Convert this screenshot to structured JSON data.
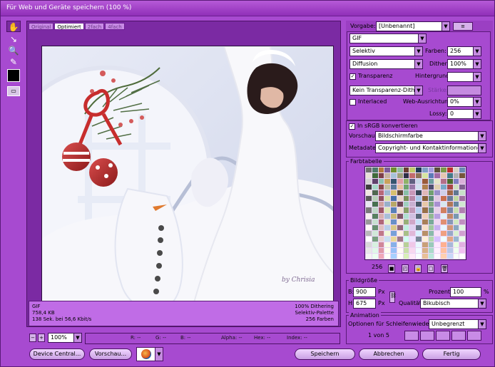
{
  "window": {
    "title": "Für Web und Geräte speichern (100 %)"
  },
  "tabs": [
    "Original",
    "Optimiert",
    "2fach",
    "4fach"
  ],
  "active_tab": 1,
  "preview": {
    "format": "GIF",
    "size": "758,4 KB",
    "time": "138 Sek. bei 56,6 Kbit/s",
    "dithering": "100% Dithering",
    "palette": "Selektiv-Palette",
    "colors": "256 Farben",
    "watermark": "by Chrisia"
  },
  "settings": {
    "preset_label": "Vorgabe:",
    "preset_value": "[Unbenannt]",
    "format": "GIF",
    "reduction": "Selektiv",
    "colors_label": "Farben:",
    "colors_value": "256",
    "dither_method": "Diffusion",
    "dither_label": "Dither:",
    "dither_value": "100%",
    "transparency_label": "Transparenz",
    "matte_label": "Hintergrund:",
    "transparency_dither": "Kein Transparenz-Dither",
    "amount_label": "Stärke:",
    "interlaced_label": "Interlaced",
    "websnap_label": "Web-Ausrichtung:",
    "websnap_value": "0%",
    "lossy_label": "Lossy:",
    "lossy_value": "0",
    "convert_srgb": "In sRGB konvertieren",
    "preview_label": "Vorschau:",
    "preview_value": "Bildschirmfarbe",
    "metadata_label": "Metadaten:",
    "metadata_value": "Copyright- und Kontaktinformationen"
  },
  "color_table": {
    "title": "Farbtabelle",
    "count": "256",
    "colors": [
      "#6e6e6e",
      "#4f7a6b",
      "#b47a3d",
      "#7c5a99",
      "#6f8f2c",
      "#8fbf9f",
      "#6b3d30",
      "#c3cc6b",
      "#1f3b54",
      "#7f9fc5",
      "#a59bdf",
      "#5c4e3a",
      "#7c9a49",
      "#bd2f2f",
      "#d8d0c2",
      "#6a8bb4",
      "#e8e0d8",
      "#3f6b3a",
      "#7e3f48",
      "#c7b5a0",
      "#a7c3d8",
      "#9e9e7a",
      "#2f2f45",
      "#c26b6b",
      "#8d7256",
      "#d6e6a1",
      "#5b7ab6",
      "#a16aa5",
      "#e6c7b1",
      "#447a88",
      "#b0b0b0",
      "#75563b",
      "#d3d3d3",
      "#60416b",
      "#8fc2b0",
      "#c9a35a",
      "#35556f",
      "#e0a0a6",
      "#90b368",
      "#5f5f80",
      "#c8d6e8",
      "#9a5a3a",
      "#6d9e9e",
      "#e6e6c8",
      "#b36f89",
      "#4a6b2e",
      "#7f7fbf",
      "#d9b0d9",
      "#3d3d3d",
      "#a8d8c8",
      "#8a4a4a",
      "#c0c0a0",
      "#5a7a9a",
      "#e8c0a0",
      "#6fa56f",
      "#9a7aaa",
      "#d0e0f0",
      "#b08050",
      "#4f4f6f",
      "#e0d0b0",
      "#7aa8c8",
      "#a84848",
      "#cfe0c0",
      "#806090",
      "#f0e8e0",
      "#506850",
      "#b86878",
      "#a0b8d0",
      "#d8c070",
      "#604838",
      "#88c0a8",
      "#c898b8",
      "#384858",
      "#e0b8b8",
      "#70a070",
      "#9890c8",
      "#d0d0e8",
      "#a06848",
      "#607890",
      "#c8e0c8",
      "#585858",
      "#b8d0b8",
      "#905060",
      "#d8e0a8",
      "#4870a8",
      "#e8d8c8",
      "#789058",
      "#b888a8",
      "#a8c8e8",
      "#886038",
      "#5a8a7a",
      "#e0c8e0",
      "#c87050",
      "#687a98",
      "#c0d8a0",
      "#a070a0",
      "#e8e8f0",
      "#487050",
      "#d0a0a0",
      "#98b0c8",
      "#b8a868",
      "#704858",
      "#a0d0c0",
      "#c8b0d0",
      "#485868",
      "#e8c8a8",
      "#80a880",
      "#a890d0",
      "#d8e8f0",
      "#b07858",
      "#6888a0",
      "#d0e8d0",
      "#787878",
      "#c0d8c8",
      "#a05868",
      "#e0e8b8",
      "#5880b8",
      "#f0e0d0",
      "#88a068",
      "#c098b8",
      "#b8d0f0",
      "#987048",
      "#6a9a8a",
      "#e8d0e8",
      "#d08060",
      "#7888a8",
      "#c8e0b0",
      "#b080b0",
      "#f8f0f0",
      "#588060",
      "#d8b0b0",
      "#a8c0d8",
      "#c8b878",
      "#805868",
      "#b0e0d0",
      "#d0c0e0",
      "#586878",
      "#f0d0b8",
      "#90b890",
      "#b8a0e0",
      "#e0f0f8",
      "#c08868",
      "#7898b0",
      "#d8f0d8",
      "#989898",
      "#c8e0d0",
      "#b06878",
      "#e8f0c8",
      "#6890c8",
      "#f8e8d8",
      "#98b078",
      "#d0a8c8",
      "#c8e0f8",
      "#a88058",
      "#7aaa9a",
      "#f0d8f0",
      "#e09070",
      "#8898b8",
      "#d0e8c0",
      "#c090c0",
      "#fff8f8",
      "#689070",
      "#e0c0c0",
      "#b8d0e8",
      "#d8c888",
      "#906878",
      "#c0f0e0",
      "#e0d0f0",
      "#687888",
      "#f8e0c8",
      "#a0c8a0",
      "#c8b0f0",
      "#e8f8ff",
      "#d09878",
      "#88a8c0",
      "#e0f8e0",
      "#b8b8b8",
      "#d0e8d8",
      "#c07888",
      "#f0f8d8",
      "#78a0d8",
      "#fff0e0",
      "#a8c088",
      "#e0b8d8",
      "#d8f0ff",
      "#b89068",
      "#8abaaa",
      "#f8e0f8",
      "#f0a080",
      "#98a8c8",
      "#d8f0d0",
      "#d0a0d0",
      "#ffffff",
      "#78a080",
      "#e8d0d0",
      "#c8e0f0",
      "#e8d898",
      "#a07888",
      "#d0fff0",
      "#f0e0ff",
      "#788898",
      "#fff0d8",
      "#b0d8b0",
      "#d8c0ff",
      "#f0ffff",
      "#e0a888",
      "#98b8d0",
      "#e8ffe8",
      "#d8d8d8",
      "#d8f0e0",
      "#d08898",
      "#f8ffe8",
      "#88b0e8",
      "#fff8f0",
      "#b8d098",
      "#f0c8e8",
      "#e8f8ff",
      "#c8a078",
      "#9acaba",
      "#ffe8ff",
      "#ffb090",
      "#a8b8d8",
      "#e8ffe0",
      "#e0b0e0",
      "#e8e8e8",
      "#e0f8e8",
      "#e098a8",
      "#fffff0",
      "#98c0f8",
      "#fffaf5",
      "#c8e0a8",
      "#f8d8f0",
      "#f0fcff",
      "#d8b088",
      "#aadaca",
      "#fff0ff",
      "#ffc0a0",
      "#b8c8e8",
      "#f0fff0",
      "#f0c0f0",
      "#f4f4f4",
      "#ecfff0",
      "#f0a8b8",
      "#fffff8",
      "#a8d0ff",
      "#fffcfa",
      "#d8f0b8",
      "#ffe8f8",
      "#f8fdff",
      "#e8c098",
      "#bae8da",
      "#fff8ff",
      "#ffd0b0",
      "#c8d8f8",
      "#f8fff8",
      "#ffffff"
    ]
  },
  "image_size": {
    "title": "Bildgröße",
    "width_label": "B:",
    "width": "900",
    "height_label": "H:",
    "height": "675",
    "unit": "Px",
    "percent_label": "Prozent:",
    "percent": "100",
    "percent_unit": "%",
    "quality_label": "Qualität:",
    "quality": "Bikubisch"
  },
  "animation": {
    "title": "Animation",
    "loop_label": "Optionen für Schleifenwiedergabe:",
    "loop_value": "Unbegrenzt",
    "frame": "1 von 5"
  },
  "zoom": {
    "value": "100%",
    "minus": "−",
    "plus": "+"
  },
  "status": {
    "r": "R: --",
    "g": "G: --",
    "b": "B: --",
    "alpha": "Alpha: --",
    "hex": "Hex: --",
    "index": "Index: --"
  },
  "buttons": {
    "device_central": "Device Central...",
    "preview": "Vorschau...",
    "save": "Speichern",
    "cancel": "Abbrechen",
    "done": "Fertig"
  },
  "accent": "#a74ad0"
}
